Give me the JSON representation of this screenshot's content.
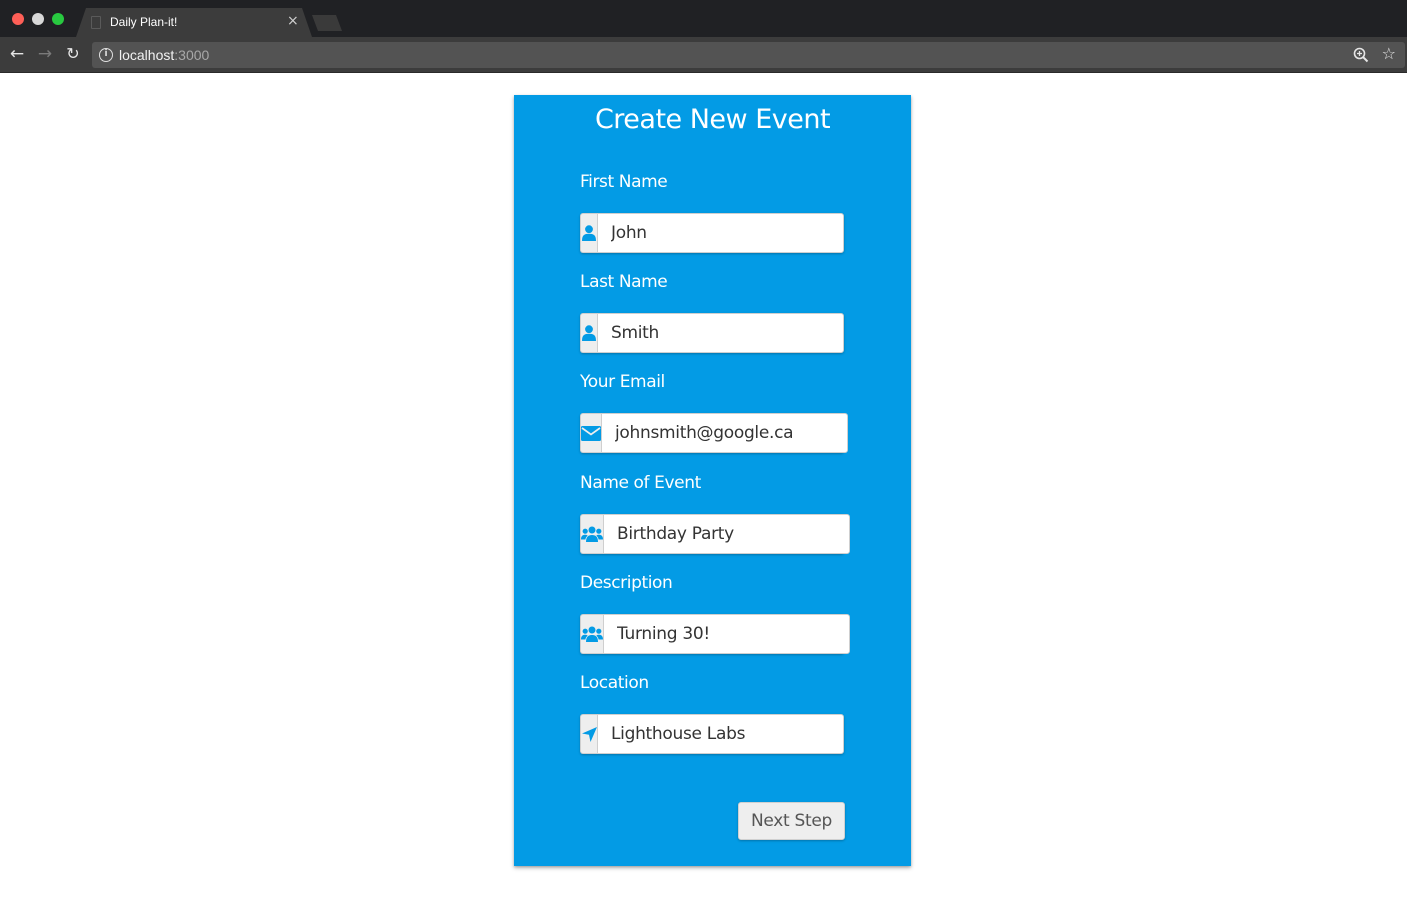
{
  "browser": {
    "tab_title": "Daily Plan-it!",
    "tab_close": "×",
    "url_host": "localhost",
    "url_port": ":3000",
    "icons": {
      "back": "arrow-left-icon",
      "forward": "arrow-right-icon",
      "reload": "reload-icon",
      "info": "info-icon",
      "zoom": "zoom-icon",
      "bookmark": "star-icon"
    }
  },
  "form": {
    "title": "Create New Event",
    "accent_color": "#039be5",
    "fields": [
      {
        "label": "First Name",
        "value": "John",
        "icon": "user-icon"
      },
      {
        "label": "Last Name",
        "value": "Smith",
        "icon": "user-icon"
      },
      {
        "label": "Your Email",
        "value": "johnsmith@google.ca",
        "icon": "envelope-icon"
      },
      {
        "label": "Name of Event",
        "value": "Birthday Party",
        "icon": "users-icon"
      },
      {
        "label": "Description",
        "value": "Turning 30!",
        "icon": "users-icon"
      },
      {
        "label": "Location",
        "value": "Lighthouse Labs",
        "icon": "location-arrow-icon"
      }
    ],
    "next_button": "Next Step"
  }
}
